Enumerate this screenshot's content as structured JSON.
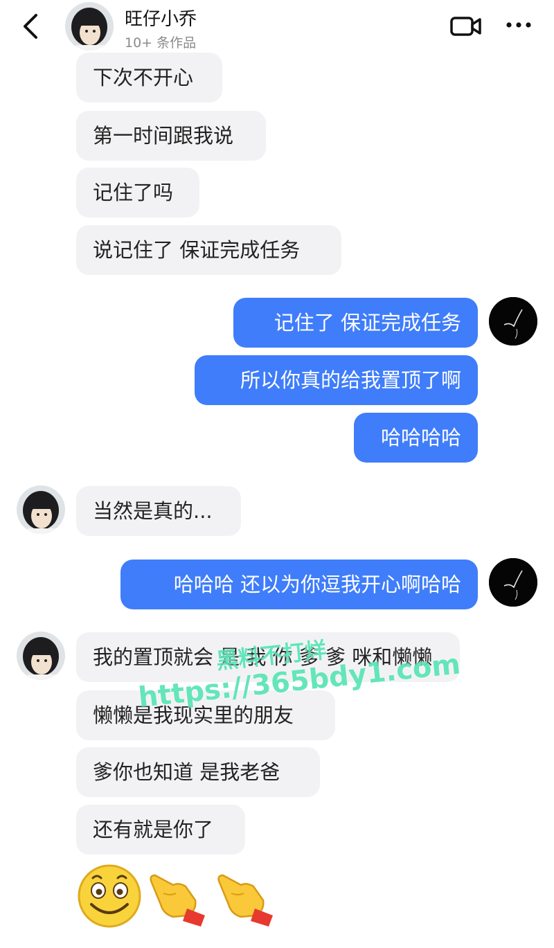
{
  "header": {
    "contact_name": "旺仔小乔",
    "contact_sub": "10+ 条作品",
    "back_icon": "chevron-left-icon",
    "video_icon": "video-call-icon",
    "more_icon": "more-horizontal-icon"
  },
  "messages": [
    {
      "side": "in",
      "text": "下次不开心"
    },
    {
      "side": "in",
      "text": "第一时间跟我说"
    },
    {
      "side": "in",
      "text": "记住了吗"
    },
    {
      "side": "in",
      "text": "说记住了 保证完成任务"
    },
    {
      "side": "out",
      "text": "记住了 保证完成任务"
    },
    {
      "side": "out",
      "text": "所以你真的给我置顶了啊"
    },
    {
      "side": "out",
      "text": "哈哈哈哈"
    },
    {
      "side": "in",
      "text": "当然是真的..."
    },
    {
      "side": "out",
      "text": "哈哈哈 还以为你逗我开心啊哈哈"
    },
    {
      "side": "in",
      "text": "我的置顶就会 是 我 你 爹 爹 咪和懒懒"
    },
    {
      "side": "in",
      "text": "懒懒是我现实里的朋友"
    },
    {
      "side": "in",
      "text": "爹你也知道 是我老爸"
    },
    {
      "side": "in",
      "text": "还有就是你了"
    }
  ],
  "emojis": [
    "smiling-face-emoji",
    "pointing-hand-emoji",
    "pointing-hand-emoji"
  ],
  "watermark": {
    "line1": "黑料不打烊",
    "line2": "https://365bdy1.com"
  },
  "colors": {
    "outgoing_bubble": "#3f7dfa",
    "incoming_bubble": "#f2f2f4",
    "watermark": "#28dca0"
  }
}
